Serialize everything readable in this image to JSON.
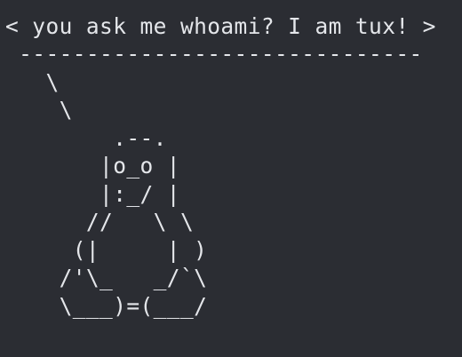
{
  "colors": {
    "background": "#2b2d33",
    "foreground": "#e4e6ea"
  },
  "terminal": {
    "lines": [
      " ------------------------------",
      "< you ask me whoami? I am tux! >",
      " ------------------------------",
      "   \\",
      "    \\",
      "        .--.",
      "       |o_o |",
      "       |:_/ |",
      "      //   \\ \\",
      "     (|     | )",
      "    /'\\_   _/`\\",
      "    \\___)=(___/"
    ]
  }
}
